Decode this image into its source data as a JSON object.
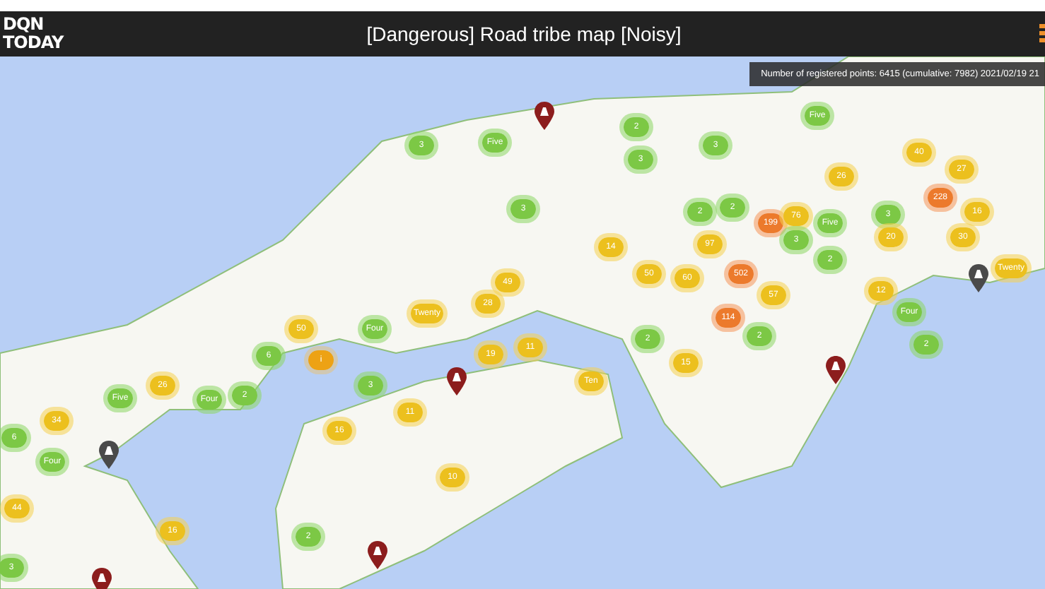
{
  "header": {
    "logo_lines": [
      "DQN",
      "TODAY"
    ],
    "title": "[Dangerous] Road tribe map [Noisy]"
  },
  "map": {
    "info": "Number of registered points: 6415 (cumulative: 7982) 2021/02/19 21",
    "clusters": [
      {
        "kind": "small",
        "label": "3"
      },
      {
        "kind": "small",
        "label": "Five"
      },
      {
        "kind": "small",
        "label": "3"
      },
      {
        "kind": "medium",
        "label": "49"
      },
      {
        "kind": "medium",
        "label": "28"
      },
      {
        "kind": "medium",
        "label": "Twenty"
      },
      {
        "kind": "small",
        "label": "Four"
      },
      {
        "kind": "medium",
        "label": "50"
      },
      {
        "kind": "small",
        "label": "2"
      },
      {
        "kind": "small",
        "label": "3"
      },
      {
        "kind": "small",
        "label": "3"
      },
      {
        "kind": "small",
        "label": "Five"
      },
      {
        "kind": "small",
        "label": "2"
      },
      {
        "kind": "small",
        "label": "2"
      },
      {
        "kind": "medium",
        "label": "14"
      },
      {
        "kind": "medium",
        "label": "50"
      },
      {
        "kind": "medium",
        "label": "60"
      },
      {
        "kind": "medium",
        "label": "97"
      },
      {
        "kind": "large",
        "label": "199"
      },
      {
        "kind": "medium",
        "label": "76"
      },
      {
        "kind": "small",
        "label": "3"
      },
      {
        "kind": "small",
        "label": "Five"
      },
      {
        "kind": "medium",
        "label": "26"
      },
      {
        "kind": "small",
        "label": "2"
      },
      {
        "kind": "large",
        "label": "502"
      },
      {
        "kind": "medium",
        "label": "57"
      },
      {
        "kind": "large",
        "label": "114"
      },
      {
        "kind": "small",
        "label": "3"
      },
      {
        "kind": "medium",
        "label": "20"
      },
      {
        "kind": "medium",
        "label": "12"
      },
      {
        "kind": "small",
        "label": "Four"
      },
      {
        "kind": "medium",
        "label": "40"
      },
      {
        "kind": "medium",
        "label": "27"
      },
      {
        "kind": "large",
        "label": "228"
      },
      {
        "kind": "medium",
        "label": "16"
      },
      {
        "kind": "medium",
        "label": "30"
      },
      {
        "kind": "medium",
        "label": "Twenty"
      },
      {
        "kind": "small",
        "label": "6"
      },
      {
        "kind": "info",
        "label": "i"
      },
      {
        "kind": "medium",
        "label": "26"
      },
      {
        "kind": "small",
        "label": "Four"
      },
      {
        "kind": "small",
        "label": "2"
      },
      {
        "kind": "small",
        "label": "Five"
      },
      {
        "kind": "medium",
        "label": "34"
      },
      {
        "kind": "small",
        "label": "6"
      },
      {
        "kind": "small",
        "label": "Four"
      },
      {
        "kind": "medium",
        "label": "44"
      },
      {
        "kind": "small",
        "label": "3"
      },
      {
        "kind": "small",
        "label": "3"
      },
      {
        "kind": "medium",
        "label": "11"
      },
      {
        "kind": "medium",
        "label": "16"
      },
      {
        "kind": "medium",
        "label": "10"
      },
      {
        "kind": "medium",
        "label": "19"
      },
      {
        "kind": "medium",
        "label": "16"
      },
      {
        "kind": "small",
        "label": "2"
      },
      {
        "kind": "medium",
        "label": "11"
      },
      {
        "kind": "medium",
        "label": "Ten"
      },
      {
        "kind": "small",
        "label": "2"
      },
      {
        "kind": "medium",
        "label": "15"
      },
      {
        "kind": "small",
        "label": "2"
      },
      {
        "kind": "small",
        "label": "2"
      }
    ],
    "pins": [
      {
        "color": "#8c1d1d"
      },
      {
        "color": "#4a4a4a"
      },
      {
        "color": "#4a4a4a"
      },
      {
        "color": "#8c1d1d"
      },
      {
        "color": "#8c1d1d"
      },
      {
        "color": "#8c1d1d"
      },
      {
        "color": "#8c1d1d"
      }
    ]
  }
}
